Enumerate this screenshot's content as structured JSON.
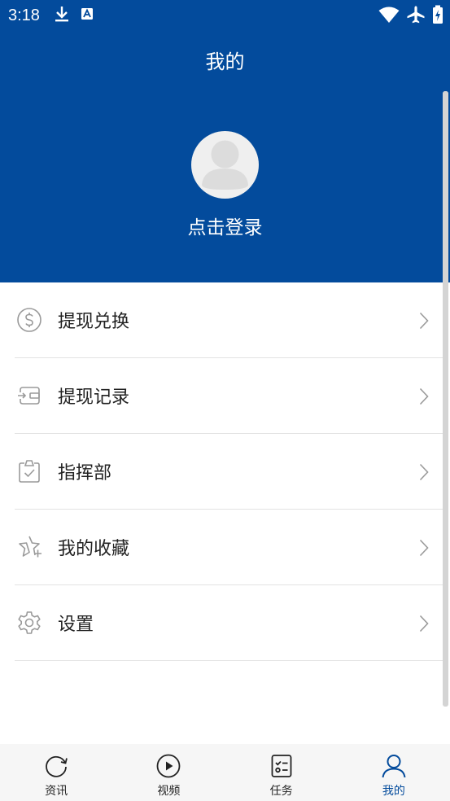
{
  "status_bar": {
    "time": "3:18",
    "left_icons": [
      "download-icon",
      "font-a-icon"
    ],
    "right_icons": [
      "wifi-icon",
      "airplane-icon",
      "battery-charging-icon"
    ]
  },
  "header": {
    "title": "我的",
    "login_text": "点击登录",
    "background_color": "#034b9c"
  },
  "menu": {
    "items": [
      {
        "label": "提现兑换",
        "icon": "dollar-circle-icon"
      },
      {
        "label": "提现记录",
        "icon": "wallet-icon"
      },
      {
        "label": "指挥部",
        "icon": "clipboard-check-icon"
      },
      {
        "label": "我的收藏",
        "icon": "star-plus-icon"
      },
      {
        "label": "设置",
        "icon": "gear-icon"
      }
    ]
  },
  "bottom_nav": {
    "tabs": [
      {
        "label": "资讯",
        "icon": "refresh-circle-icon",
        "active": false
      },
      {
        "label": "视频",
        "icon": "play-circle-icon",
        "active": false
      },
      {
        "label": "任务",
        "icon": "task-list-icon",
        "active": false
      },
      {
        "label": "我的",
        "icon": "user-icon",
        "active": true
      }
    ],
    "active_color": "#034b9c"
  }
}
